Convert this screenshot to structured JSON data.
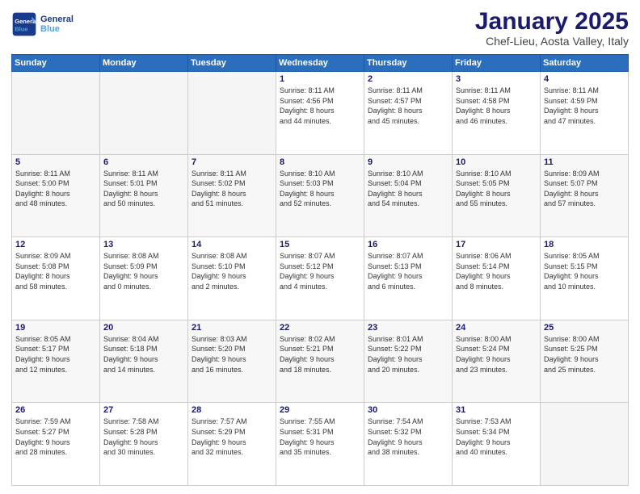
{
  "header": {
    "logo_line1": "General",
    "logo_line2": "Blue",
    "title": "January 2025",
    "subtitle": "Chef-Lieu, Aosta Valley, Italy"
  },
  "days_of_week": [
    "Sunday",
    "Monday",
    "Tuesday",
    "Wednesday",
    "Thursday",
    "Friday",
    "Saturday"
  ],
  "weeks": [
    [
      {
        "day": "",
        "text": ""
      },
      {
        "day": "",
        "text": ""
      },
      {
        "day": "",
        "text": ""
      },
      {
        "day": "1",
        "text": "Sunrise: 8:11 AM\nSunset: 4:56 PM\nDaylight: 8 hours\nand 44 minutes."
      },
      {
        "day": "2",
        "text": "Sunrise: 8:11 AM\nSunset: 4:57 PM\nDaylight: 8 hours\nand 45 minutes."
      },
      {
        "day": "3",
        "text": "Sunrise: 8:11 AM\nSunset: 4:58 PM\nDaylight: 8 hours\nand 46 minutes."
      },
      {
        "day": "4",
        "text": "Sunrise: 8:11 AM\nSunset: 4:59 PM\nDaylight: 8 hours\nand 47 minutes."
      }
    ],
    [
      {
        "day": "5",
        "text": "Sunrise: 8:11 AM\nSunset: 5:00 PM\nDaylight: 8 hours\nand 48 minutes."
      },
      {
        "day": "6",
        "text": "Sunrise: 8:11 AM\nSunset: 5:01 PM\nDaylight: 8 hours\nand 50 minutes."
      },
      {
        "day": "7",
        "text": "Sunrise: 8:11 AM\nSunset: 5:02 PM\nDaylight: 8 hours\nand 51 minutes."
      },
      {
        "day": "8",
        "text": "Sunrise: 8:10 AM\nSunset: 5:03 PM\nDaylight: 8 hours\nand 52 minutes."
      },
      {
        "day": "9",
        "text": "Sunrise: 8:10 AM\nSunset: 5:04 PM\nDaylight: 8 hours\nand 54 minutes."
      },
      {
        "day": "10",
        "text": "Sunrise: 8:10 AM\nSunset: 5:05 PM\nDaylight: 8 hours\nand 55 minutes."
      },
      {
        "day": "11",
        "text": "Sunrise: 8:09 AM\nSunset: 5:07 PM\nDaylight: 8 hours\nand 57 minutes."
      }
    ],
    [
      {
        "day": "12",
        "text": "Sunrise: 8:09 AM\nSunset: 5:08 PM\nDaylight: 8 hours\nand 58 minutes."
      },
      {
        "day": "13",
        "text": "Sunrise: 8:08 AM\nSunset: 5:09 PM\nDaylight: 9 hours\nand 0 minutes."
      },
      {
        "day": "14",
        "text": "Sunrise: 8:08 AM\nSunset: 5:10 PM\nDaylight: 9 hours\nand 2 minutes."
      },
      {
        "day": "15",
        "text": "Sunrise: 8:07 AM\nSunset: 5:12 PM\nDaylight: 9 hours\nand 4 minutes."
      },
      {
        "day": "16",
        "text": "Sunrise: 8:07 AM\nSunset: 5:13 PM\nDaylight: 9 hours\nand 6 minutes."
      },
      {
        "day": "17",
        "text": "Sunrise: 8:06 AM\nSunset: 5:14 PM\nDaylight: 9 hours\nand 8 minutes."
      },
      {
        "day": "18",
        "text": "Sunrise: 8:05 AM\nSunset: 5:15 PM\nDaylight: 9 hours\nand 10 minutes."
      }
    ],
    [
      {
        "day": "19",
        "text": "Sunrise: 8:05 AM\nSunset: 5:17 PM\nDaylight: 9 hours\nand 12 minutes."
      },
      {
        "day": "20",
        "text": "Sunrise: 8:04 AM\nSunset: 5:18 PM\nDaylight: 9 hours\nand 14 minutes."
      },
      {
        "day": "21",
        "text": "Sunrise: 8:03 AM\nSunset: 5:20 PM\nDaylight: 9 hours\nand 16 minutes."
      },
      {
        "day": "22",
        "text": "Sunrise: 8:02 AM\nSunset: 5:21 PM\nDaylight: 9 hours\nand 18 minutes."
      },
      {
        "day": "23",
        "text": "Sunrise: 8:01 AM\nSunset: 5:22 PM\nDaylight: 9 hours\nand 20 minutes."
      },
      {
        "day": "24",
        "text": "Sunrise: 8:00 AM\nSunset: 5:24 PM\nDaylight: 9 hours\nand 23 minutes."
      },
      {
        "day": "25",
        "text": "Sunrise: 8:00 AM\nSunset: 5:25 PM\nDaylight: 9 hours\nand 25 minutes."
      }
    ],
    [
      {
        "day": "26",
        "text": "Sunrise: 7:59 AM\nSunset: 5:27 PM\nDaylight: 9 hours\nand 28 minutes."
      },
      {
        "day": "27",
        "text": "Sunrise: 7:58 AM\nSunset: 5:28 PM\nDaylight: 9 hours\nand 30 minutes."
      },
      {
        "day": "28",
        "text": "Sunrise: 7:57 AM\nSunset: 5:29 PM\nDaylight: 9 hours\nand 32 minutes."
      },
      {
        "day": "29",
        "text": "Sunrise: 7:55 AM\nSunset: 5:31 PM\nDaylight: 9 hours\nand 35 minutes."
      },
      {
        "day": "30",
        "text": "Sunrise: 7:54 AM\nSunset: 5:32 PM\nDaylight: 9 hours\nand 38 minutes."
      },
      {
        "day": "31",
        "text": "Sunrise: 7:53 AM\nSunset: 5:34 PM\nDaylight: 9 hours\nand 40 minutes."
      },
      {
        "day": "",
        "text": ""
      }
    ]
  ]
}
